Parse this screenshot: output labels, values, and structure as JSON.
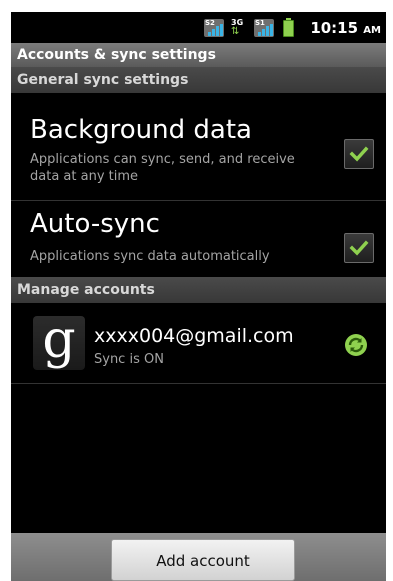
{
  "status_bar": {
    "signal_labels": [
      "S2",
      "3G",
      "S1"
    ],
    "time": "10:15",
    "ampm": "AM"
  },
  "title": "Accounts & sync settings",
  "general": {
    "header": "General sync settings",
    "background_data": {
      "title": "Background data",
      "summary": "Applications can sync, send, and receive data at any time",
      "checked": true
    },
    "auto_sync": {
      "title": "Auto-sync",
      "summary": "Applications sync data automatically",
      "checked": true
    }
  },
  "manage": {
    "header": "Manage accounts",
    "accounts": [
      {
        "icon": "google-icon",
        "email": "xxxx004@gmail.com",
        "status": "Sync is ON",
        "sync_icon": "sync-icon"
      }
    ]
  },
  "add_account_label": "Add account",
  "colors": {
    "check": "#8fd14f",
    "sync_green": "#8fd14f"
  }
}
